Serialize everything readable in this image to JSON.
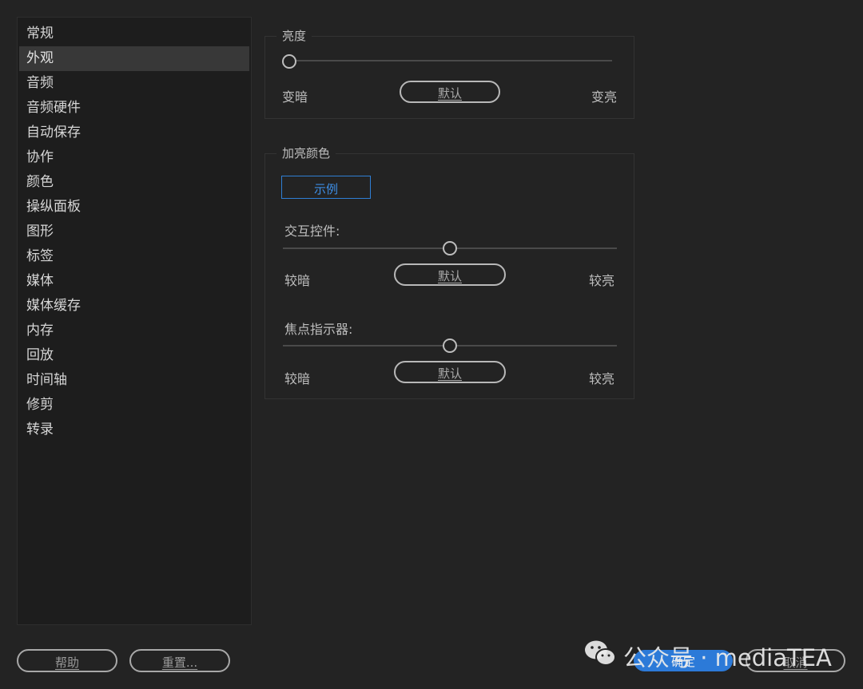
{
  "sidebar": {
    "items": [
      "常规",
      "外观",
      "音频",
      "音频硬件",
      "自动保存",
      "协作",
      "颜色",
      "操纵面板",
      "图形",
      "标签",
      "媒体",
      "媒体缓存",
      "内存",
      "回放",
      "时间轴",
      "修剪",
      "转录"
    ],
    "selected": "外观"
  },
  "brightness": {
    "title": "亮度",
    "dark_label": "变暗",
    "bright_label": "变亮",
    "default_label": "默认",
    "level": 0
  },
  "highlight": {
    "title": "加亮颜色",
    "sample_label": "示例",
    "sample_color": "#2f7fd5",
    "interactive_controls": {
      "label": "交互控件:",
      "dark_label": "较暗",
      "bright_label": "较亮",
      "default_label": "默认",
      "level": 0.5
    },
    "focus_indicator": {
      "label": "焦点指示器:",
      "dark_label": "较暗",
      "bright_label": "较亮",
      "default_label": "默认",
      "level": 0.5
    }
  },
  "footer": {
    "help_label": "帮助",
    "reset_label": "重置...",
    "ok_label": "确定",
    "cancel_label": "取消",
    "ok_color": "#2c7ad8"
  },
  "watermark": {
    "text": "公众号 · mediaTEA",
    "icon": "wechat-icon"
  }
}
